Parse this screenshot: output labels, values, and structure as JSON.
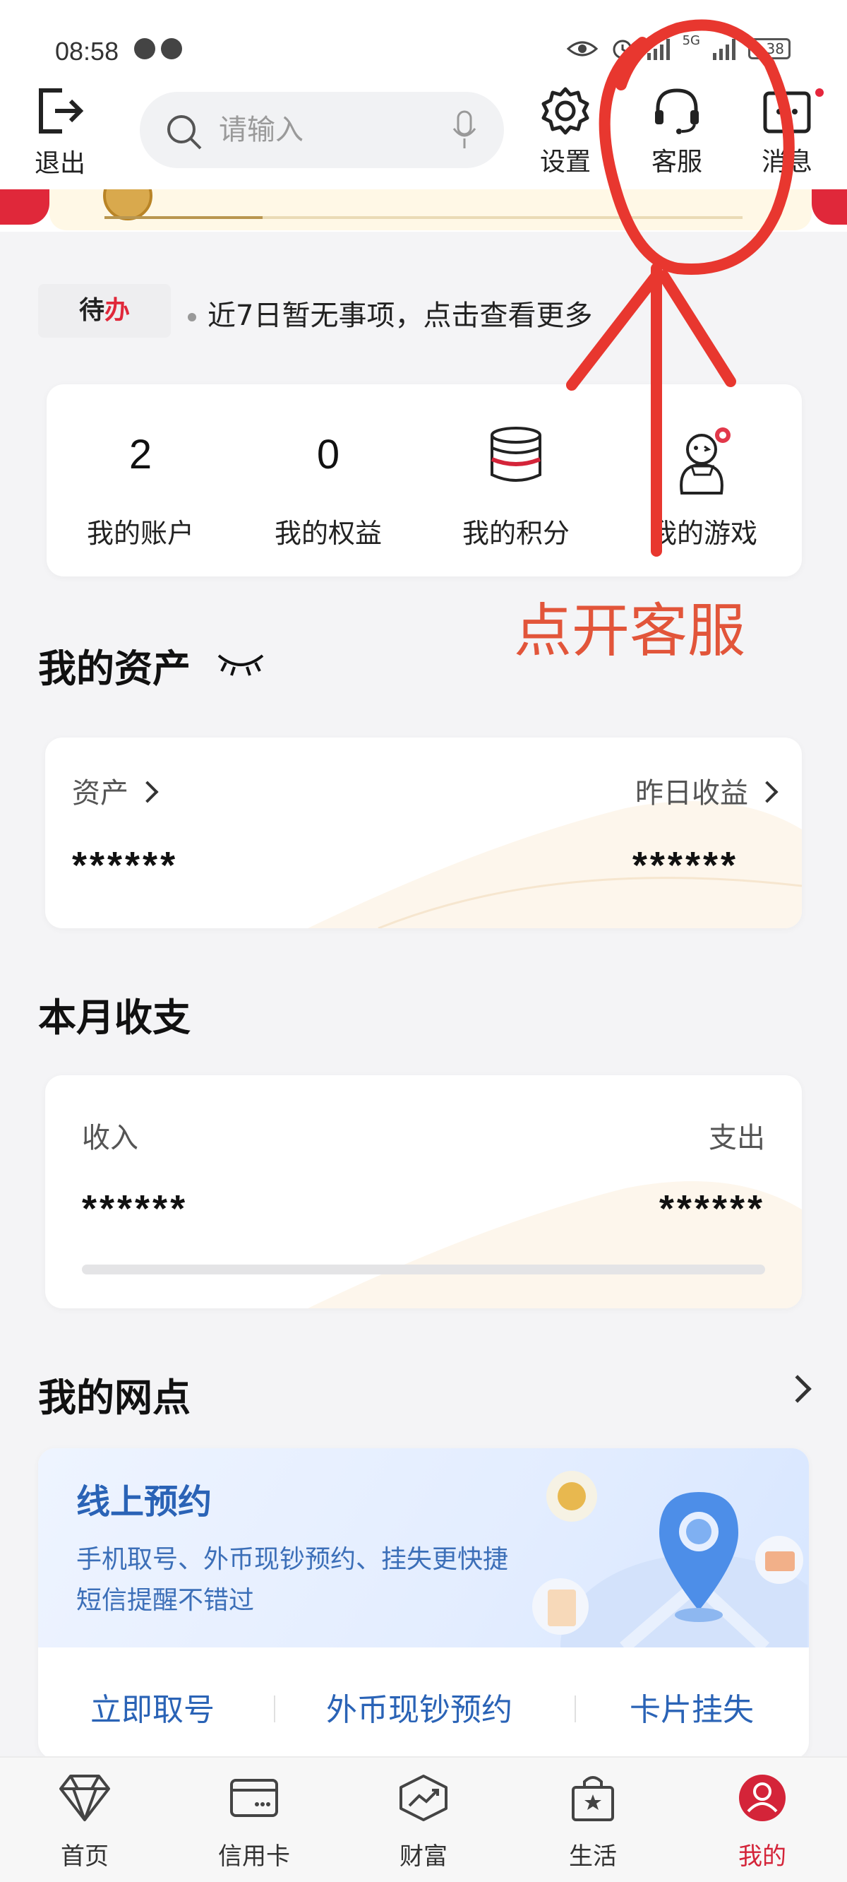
{
  "status_bar": {
    "time": "08:58",
    "net": "5G",
    "battery": "38"
  },
  "top_bar": {
    "logout_label": "退出",
    "search_placeholder": "请输入",
    "settings_label": "设置",
    "service_label": "客服",
    "messages_label": "消息"
  },
  "todo": {
    "tag": "待办",
    "text": "近7日暂无事项，点击查看更多"
  },
  "quick": [
    {
      "value": "2",
      "label": "我的账户"
    },
    {
      "value": "0",
      "label": "我的权益"
    },
    {
      "icon": "coin-stack-icon",
      "label": "我的积分"
    },
    {
      "icon": "snowman-icon",
      "label": "我的游戏"
    }
  ],
  "assets": {
    "title": "我的资产",
    "left_label": "资产",
    "right_label": "昨日收益",
    "left_value": "******",
    "right_value": "******"
  },
  "monthly": {
    "title": "本月收支",
    "income_label": "收入",
    "expense_label": "支出",
    "income_value": "******",
    "expense_value": "******"
  },
  "branch": {
    "title": "我的网点",
    "card_title": "线上预约",
    "desc_line1": "手机取号、外币现钞预约、挂失更快捷",
    "desc_line2": "短信提醒不错过",
    "actions": [
      "立即取号",
      "外币现钞预约",
      "卡片挂失"
    ]
  },
  "tabs": [
    {
      "label": "首页",
      "icon": "diamond-icon"
    },
    {
      "label": "信用卡",
      "icon": "credit-card-icon"
    },
    {
      "label": "财富",
      "icon": "wealth-chart-icon"
    },
    {
      "label": "生活",
      "icon": "shopping-bag-icon"
    },
    {
      "label": "我的",
      "icon": "user-icon",
      "active": true
    }
  ],
  "annotation": {
    "text": "点开客服",
    "color": "#e2553a"
  },
  "colors": {
    "brand_red": "#d42439",
    "link_blue": "#2a63b6"
  }
}
